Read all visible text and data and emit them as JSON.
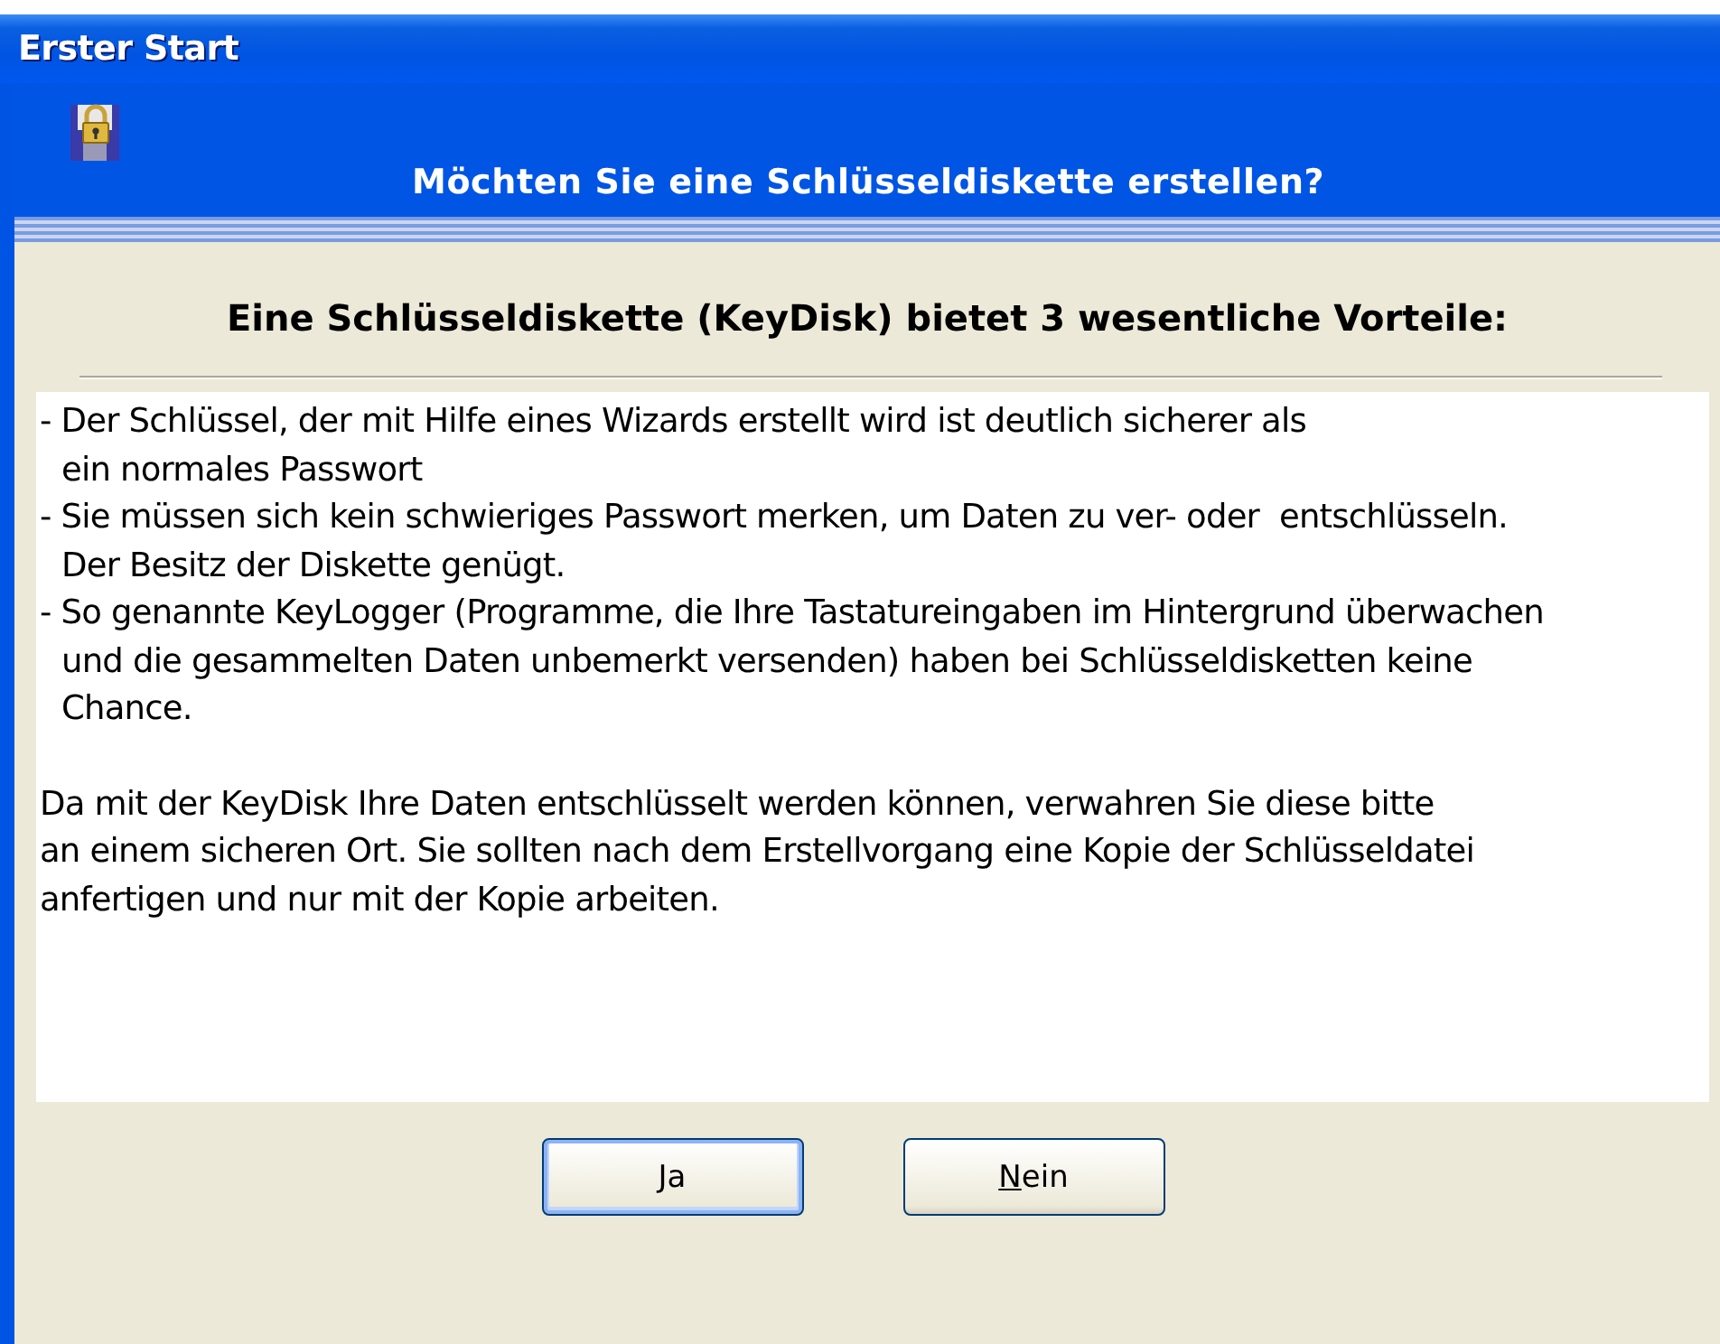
{
  "window": {
    "title": "Erster Start"
  },
  "header": {
    "title": "Möchten Sie eine Schlüsseldiskette erstellen?"
  },
  "heading": "Eine Schlüsseldiskette (KeyDisk) bietet 3 wesentliche Vorteile:",
  "content": [
    {
      "kind": "bullet",
      "lines": [
        "- Der Schlüssel, der mit Hilfe eines Wizards erstellt wird ist deutlich sicherer als",
        "ein normales Passwort"
      ]
    },
    {
      "kind": "bullet",
      "lines": [
        "- Sie müssen sich kein schwieriges Passwort merken, um Daten zu ver- oder  entschlüsseln.",
        "Der Besitz der Diskette genügt."
      ]
    },
    {
      "kind": "bullet",
      "lines": [
        "- So genannte KeyLogger (Programme, die Ihre Tastatureingaben im Hintergrund überwachen",
        "und die gesammelten Daten unbemerkt versenden) haben bei Schlüsseldisketten keine",
        "Chance."
      ]
    },
    {
      "kind": "paragraph",
      "lines": [
        "Da mit der KeyDisk Ihre Daten entschlüsselt werden können, verwahren Sie diese bitte",
        "an einem sicheren Ort. Sie sollten nach dem Erstellvorgang eine Kopie der Schlüsseldatei",
        "anfertigen und nur mit der Kopie arbeiten."
      ]
    }
  ],
  "buttons": [
    {
      "label": "Ja",
      "default": true
    },
    {
      "label": "Nein",
      "default": false
    }
  ]
}
